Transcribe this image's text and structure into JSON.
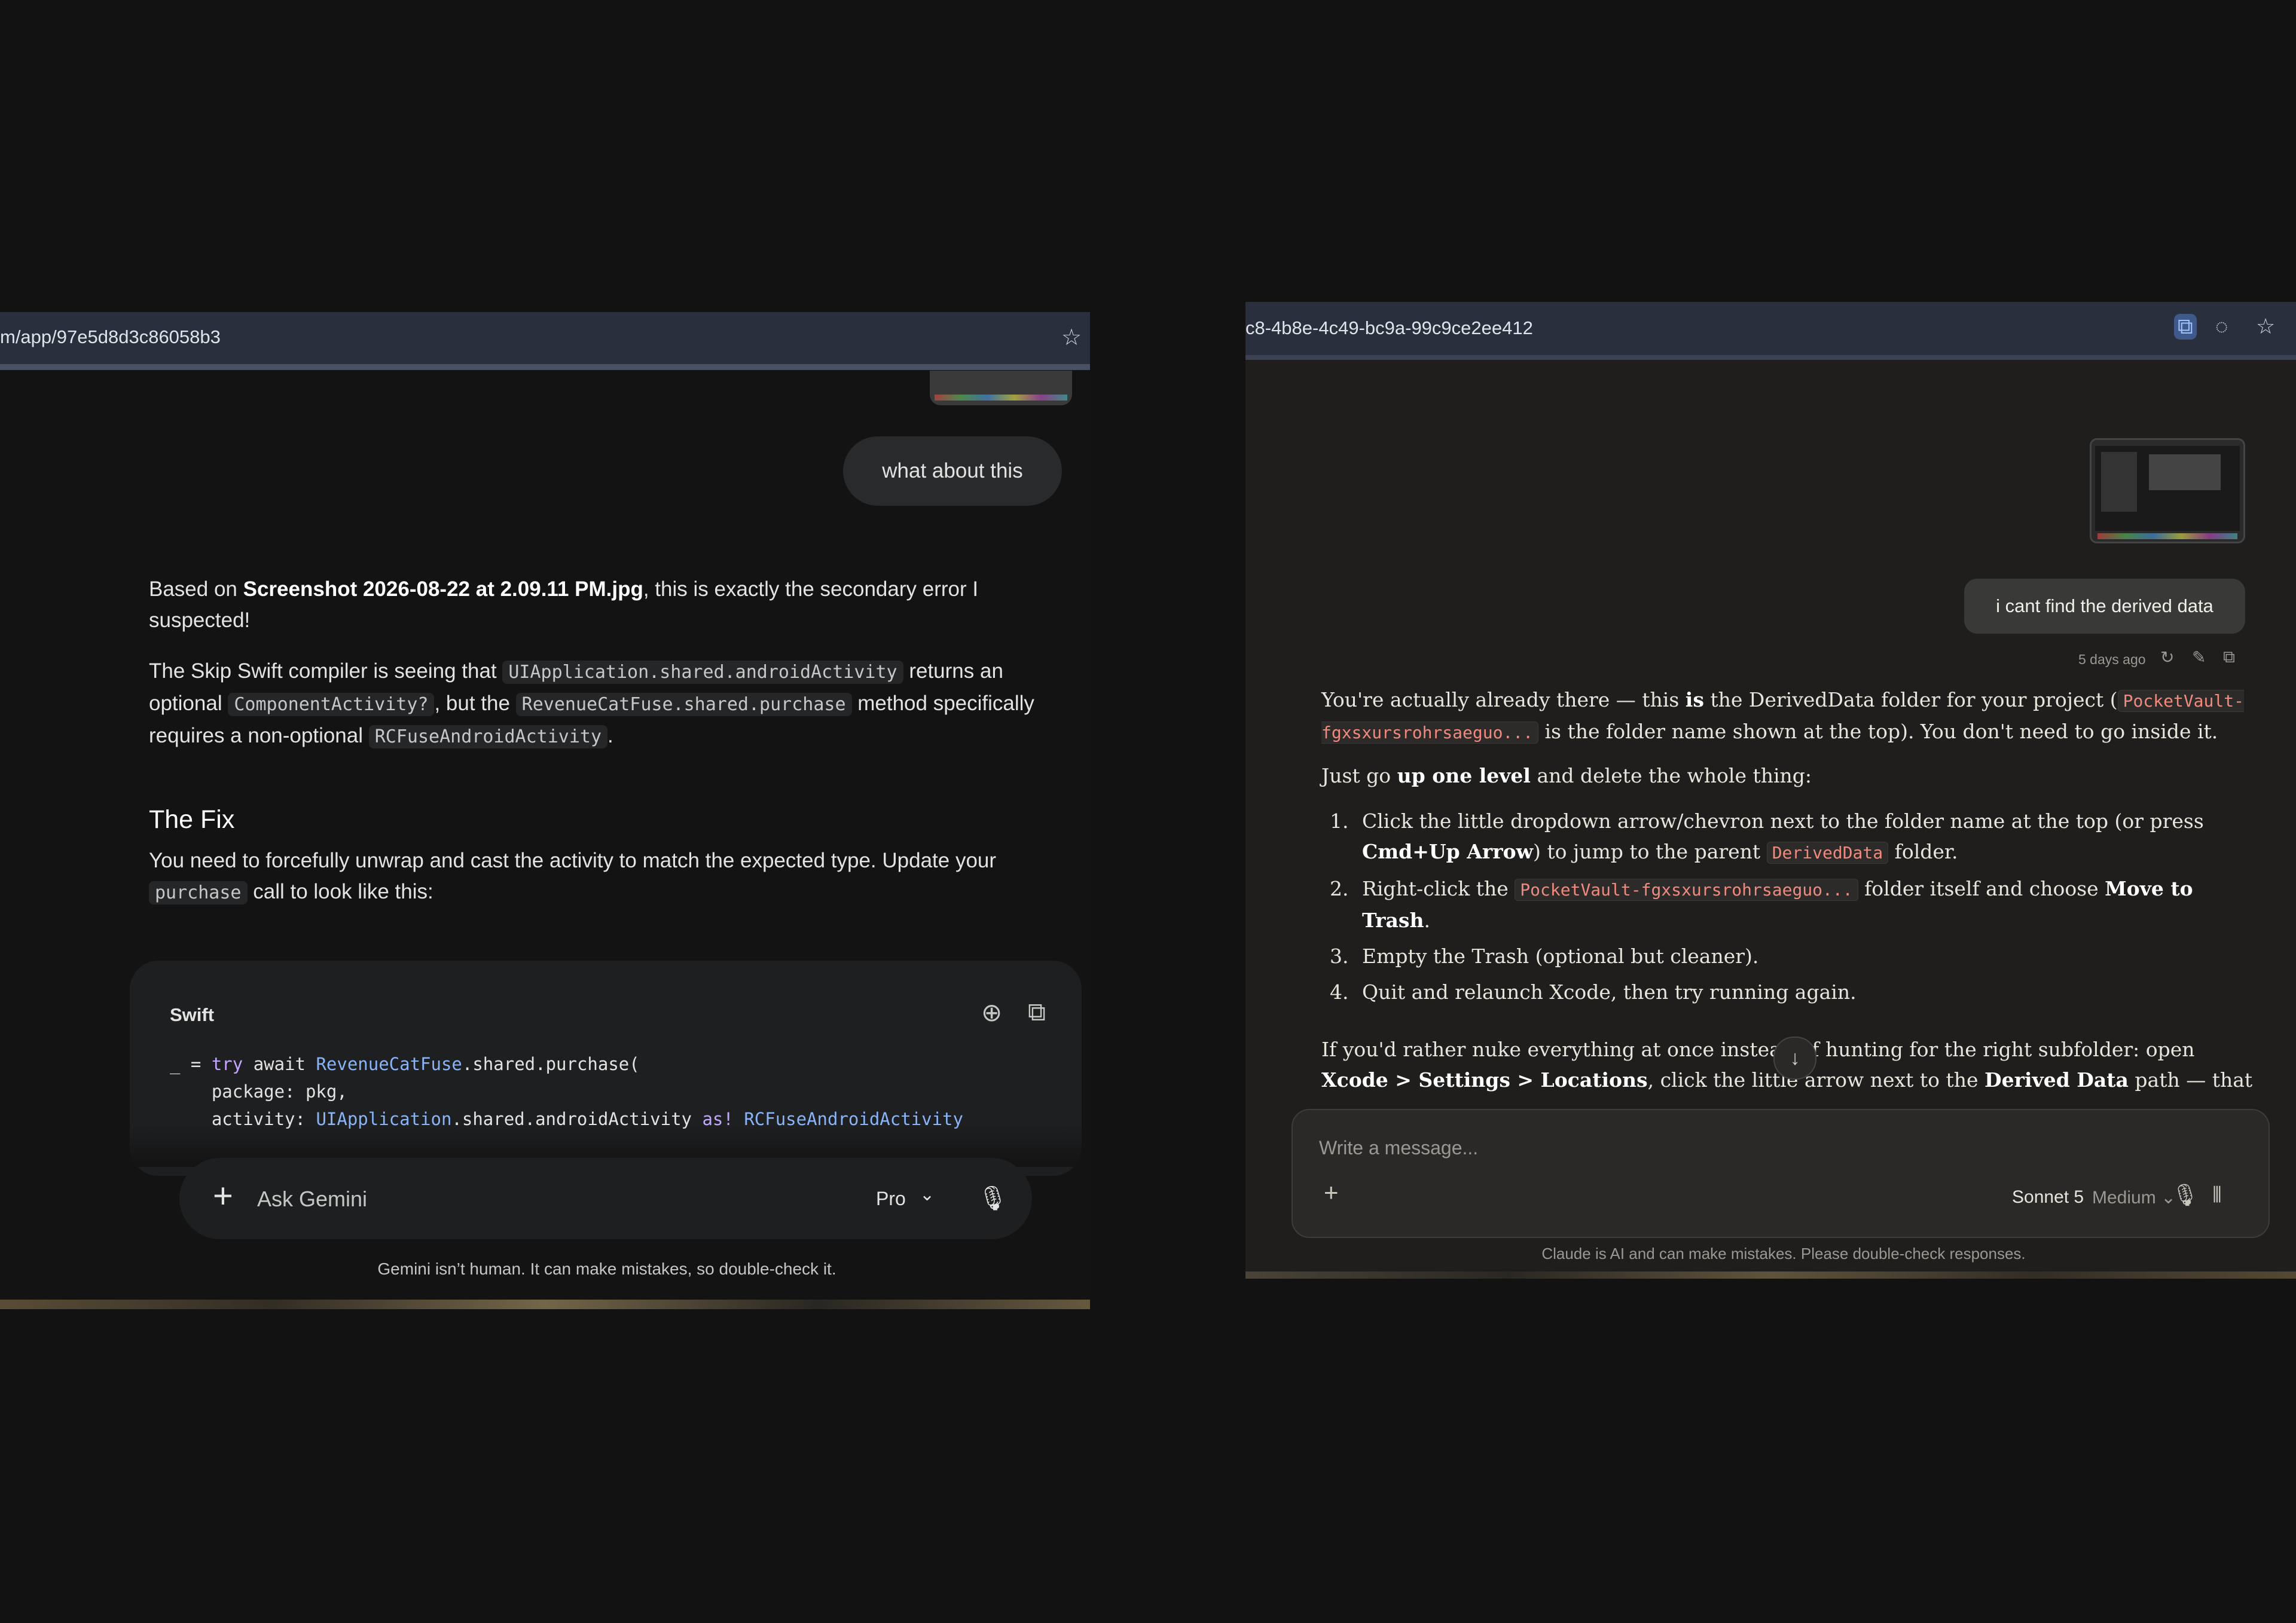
{
  "gemini": {
    "url": "m/app/97e5d8d3c86058b3",
    "user_message": "what about this",
    "response": {
      "p1_a": "Based on ",
      "p1_file": "Screenshot 2026-08-22 at 2.09.11 PM.jpg",
      "p1_b": ", this is exactly the secondary error I suspected!",
      "p2_a": "The Skip Swift compiler is seeing that ",
      "p2_code1": "UIApplication.shared.androidActivity",
      "p2_b": " returns an optional ",
      "p2_code2": "ComponentActivity?",
      "p2_c": ", but the ",
      "p2_code3": "RevenueCatFuse.shared.purchase",
      "p2_d": " method specifically requires a non-optional ",
      "p2_code4": "RCFuseAndroidActivity",
      "p2_e": ".",
      "heading": "The Fix",
      "p3_a": "You need to forcefully unwrap and cast the activity to match the expected type. Update your ",
      "p3_code": "purchase",
      "p3_b": " call to look like this:"
    },
    "code_block": {
      "language": "Swift",
      "line1_a": "_ = ",
      "line1_kw1": "try",
      "line1_b": " await ",
      "line1_type": "RevenueCatFuse",
      "line1_c": ".shared.purchase(",
      "line2": "    package: pkg,",
      "line3_a": "    activity: ",
      "line3_type1": "UIApplication",
      "line3_b": ".shared.androidActivity ",
      "line3_kw": "as!",
      "line3_c": " ",
      "line3_type2": "RCFuseAndroidActivity",
      "download_icon": "download-icon",
      "copy_icon": "copy-icon"
    },
    "input": {
      "placeholder": "Ask Gemini",
      "model": "Pro"
    },
    "disclaimer": "Gemini isn’t human. It can make mistakes, so double-check it."
  },
  "claude": {
    "url": "c8-4b8e-4c49-bc9a-99c9ce2ee412",
    "user_message": "i cant find the derived data",
    "timestamp": "5 days ago",
    "response": {
      "p1_a": "You're actually already there — this ",
      "p1_bold": "is",
      "p1_b": " the DerivedData folder for your project (",
      "p1_code": "PocketVault-fgxsxursrohrsaeguo...",
      "p1_c": " is the folder name shown at the top). You don't need to go inside it.",
      "p2_a": "Just go ",
      "p2_bold": "up one level",
      "p2_b": " and delete the whole thing:",
      "steps": [
        {
          "num": "1.",
          "a": "Click the little dropdown arrow/chevron next to the folder name at the top (or press ",
          "bold": "Cmd+Up Arrow",
          "b": ") to jump to the parent ",
          "code": "DerivedData",
          "c": " folder."
        },
        {
          "num": "2.",
          "a": "Right-click the ",
          "code": "PocketVault-fgxsxursrohrsaeguo...",
          "b": " folder itself and choose ",
          "bold": "Move to Trash",
          "c": "."
        },
        {
          "num": "3.",
          "text": "Empty the Trash (optional but cleaner)."
        },
        {
          "num": "4.",
          "text": "Quit and relaunch Xcode, then try running again."
        }
      ],
      "p3_a": "If you'd rather nuke everything at once instead of hunting for the right subfolder: open ",
      "p3_bold1": "Xcode > Settings > Locations",
      "p3_b": ", click the little arrow next to the ",
      "p3_bold2": "Derived Data",
      "p3_c": " path — that opens"
    },
    "input": {
      "placeholder": "Write a message...",
      "model": "Sonnet 5",
      "effort": "Medium"
    },
    "disclaimer": "Claude is AI and can make mistakes. Please double-check responses."
  }
}
